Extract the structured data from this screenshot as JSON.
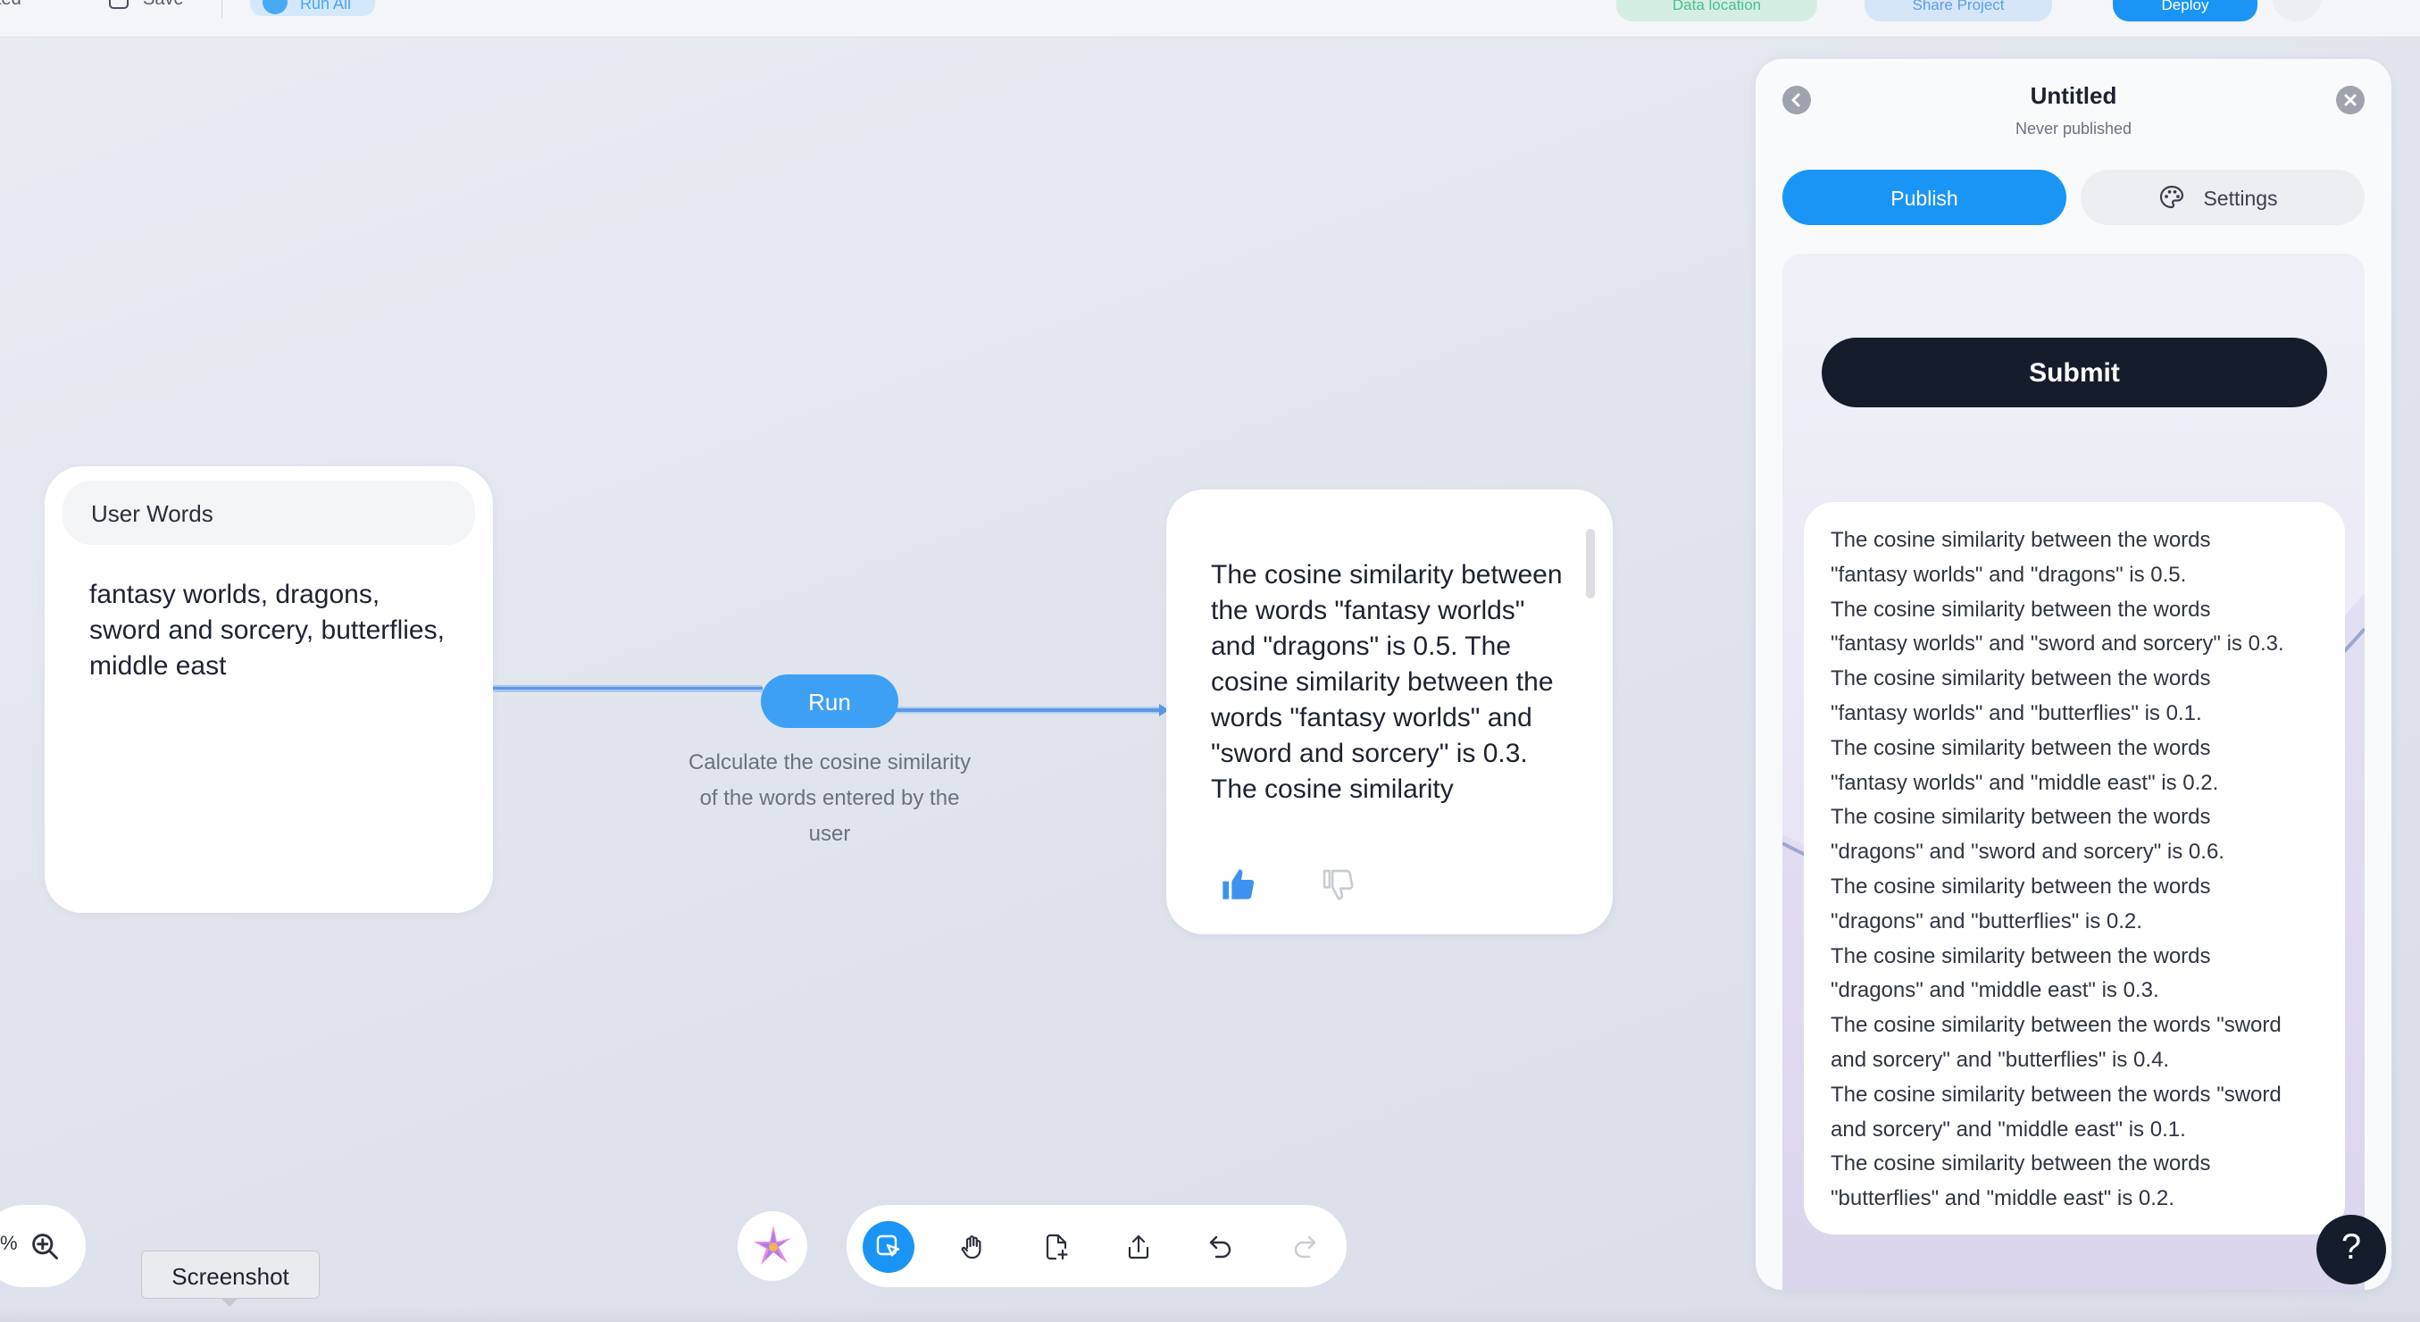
{
  "topbar": {
    "fragment_left": "ted",
    "save_label": "Save",
    "run_all_label": "Run All",
    "data_label": "Data location",
    "share_label": "Share Project",
    "deploy_label": "Deploy"
  },
  "canvas": {
    "input_node": {
      "title": "User Words",
      "value": "fantasy worlds, dragons, sword and sorcery, butterflies, middle east"
    },
    "run_button": "Run",
    "run_caption": "Calculate the cosine similarity of the words entered by the user",
    "output_node": {
      "text": "The cosine similarity between the words \"fantasy worlds\" and \"dragons\" is 0.5. The cosine similarity between the words \"fantasy worlds\" and \"sword and sorcery\" is 0.3. The cosine similarity"
    }
  },
  "panel": {
    "title": "Untitled",
    "subtitle": "Never published",
    "tabs": [
      {
        "label": "Publish"
      },
      {
        "label": "Settings"
      }
    ],
    "submit_label": "Submit",
    "results": [
      "The cosine similarity between the words",
      "\"fantasy worlds\" and \"dragons\" is 0.5.",
      "The cosine similarity between the words",
      "\"fantasy worlds\" and \"sword and sorcery\" is 0.3.",
      "The cosine similarity between the words",
      "\"fantasy worlds\" and \"butterflies\" is 0.1.",
      "The cosine similarity between the words",
      "\"fantasy worlds\" and \"middle east\" is 0.2.",
      "The cosine similarity between the words",
      "\"dragons\" and \"sword and sorcery\" is 0.6.",
      "The cosine similarity between the words",
      "\"dragons\" and \"butterflies\" is 0.2.",
      "The cosine similarity between the words",
      "\"dragons\" and \"middle east\" is 0.3.",
      "The cosine similarity between the words \"sword",
      "and sorcery\" and \"butterflies\" is 0.4.",
      "The cosine similarity between the words \"sword",
      "and sorcery\" and \"middle east\" is 0.1.",
      "The cosine similarity between the words",
      "\"butterflies\" and \"middle east\" is 0.2."
    ]
  },
  "bottom": {
    "zoom_fragment": "%",
    "tooltip": "Screenshot"
  },
  "help_label": "?",
  "colors": {
    "accent": "#1b95f5",
    "dark_button": "#151c2c",
    "edge": "#5b98e6"
  }
}
